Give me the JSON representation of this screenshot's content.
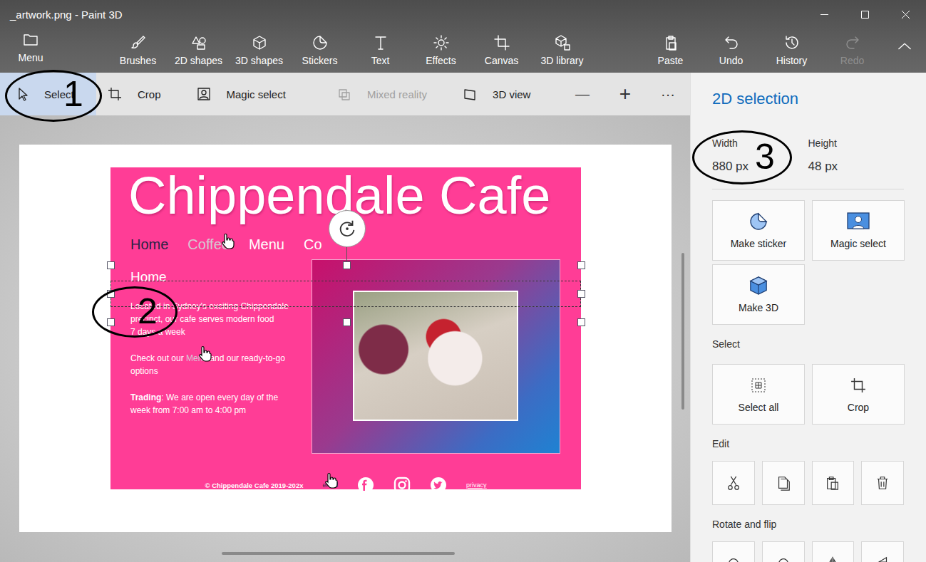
{
  "window": {
    "title": "_artwork.png - Paint 3D"
  },
  "ribbon": {
    "menu": {
      "label": "Menu"
    },
    "tools": [
      {
        "label": "Brushes"
      },
      {
        "label": "2D shapes"
      },
      {
        "label": "3D shapes"
      },
      {
        "label": "Stickers"
      },
      {
        "label": "Text"
      },
      {
        "label": "Effects"
      },
      {
        "label": "Canvas"
      },
      {
        "label": "3D library"
      }
    ],
    "actions": [
      {
        "label": "Paste",
        "disabled": false
      },
      {
        "label": "Undo",
        "disabled": false
      },
      {
        "label": "History",
        "disabled": false
      },
      {
        "label": "Redo",
        "disabled": true
      }
    ]
  },
  "subbar": {
    "tools": [
      {
        "label": "Select",
        "selected": true,
        "disabled": false
      },
      {
        "label": "Crop",
        "selected": false,
        "disabled": false
      },
      {
        "label": "Magic select",
        "selected": false,
        "disabled": false
      },
      {
        "label": "Mixed reality",
        "selected": false,
        "disabled": true
      },
      {
        "label": "3D view",
        "selected": false,
        "disabled": false
      }
    ],
    "zoom_out": "—",
    "zoom_in": "+",
    "more": "···"
  },
  "artwork": {
    "title": "Chippendale Cafe",
    "nav": [
      {
        "label": "Home",
        "selected": true,
        "hovered": false
      },
      {
        "label": "Coffee",
        "selected": false,
        "hovered": true
      },
      {
        "label": "Menu",
        "selected": false,
        "hovered": false
      },
      {
        "label": "Co",
        "selected": false,
        "hovered": false
      }
    ],
    "heading": "Home",
    "paragraphs": [
      {
        "lines": [
          [
            {
              "text": "Located in Sydney's exciting Chippendale",
              "kind": "plain"
            }
          ],
          [
            {
              "text": "precinct, our cafe serves modern food",
              "kind": "plain"
            }
          ],
          [
            {
              "text": "7 days a week",
              "kind": "plain"
            }
          ]
        ]
      },
      {
        "lines": [
          [
            {
              "text": "Check out our ",
              "kind": "plain"
            },
            {
              "text": "Menu",
              "kind": "link"
            },
            {
              "text": " and our ready-to-go",
              "kind": "plain"
            }
          ],
          [
            {
              "text": "options",
              "kind": "plain"
            }
          ]
        ]
      },
      {
        "lines": [
          [
            {
              "text": "Trading",
              "kind": "bold"
            },
            {
              "text": ": We are open every day of the",
              "kind": "plain"
            }
          ],
          [
            {
              "text": "week from 7:00 am to 4:00 pm",
              "kind": "plain"
            }
          ]
        ]
      }
    ],
    "footer": {
      "copyright": "© Chippendale Cafe 2019-202x",
      "email": "email",
      "privacy": "privacy"
    }
  },
  "panel": {
    "title": "2D selection",
    "dimensions": [
      {
        "label": "Width",
        "value": "880 px"
      },
      {
        "label": "Height",
        "value": "48 px"
      }
    ],
    "actions": [
      {
        "label": "Make sticker"
      },
      {
        "label": "Magic select"
      },
      {
        "label": "Make 3D"
      }
    ],
    "select_section": {
      "title": "Select",
      "buttons": [
        {
          "label": "Select all"
        },
        {
          "label": "Crop"
        }
      ]
    },
    "edit_section": {
      "title": "Edit"
    },
    "rotate_section": {
      "title": "Rotate and flip"
    }
  },
  "annotations": [
    {
      "label": "1"
    },
    {
      "label": "2"
    },
    {
      "label": "3"
    }
  ]
}
